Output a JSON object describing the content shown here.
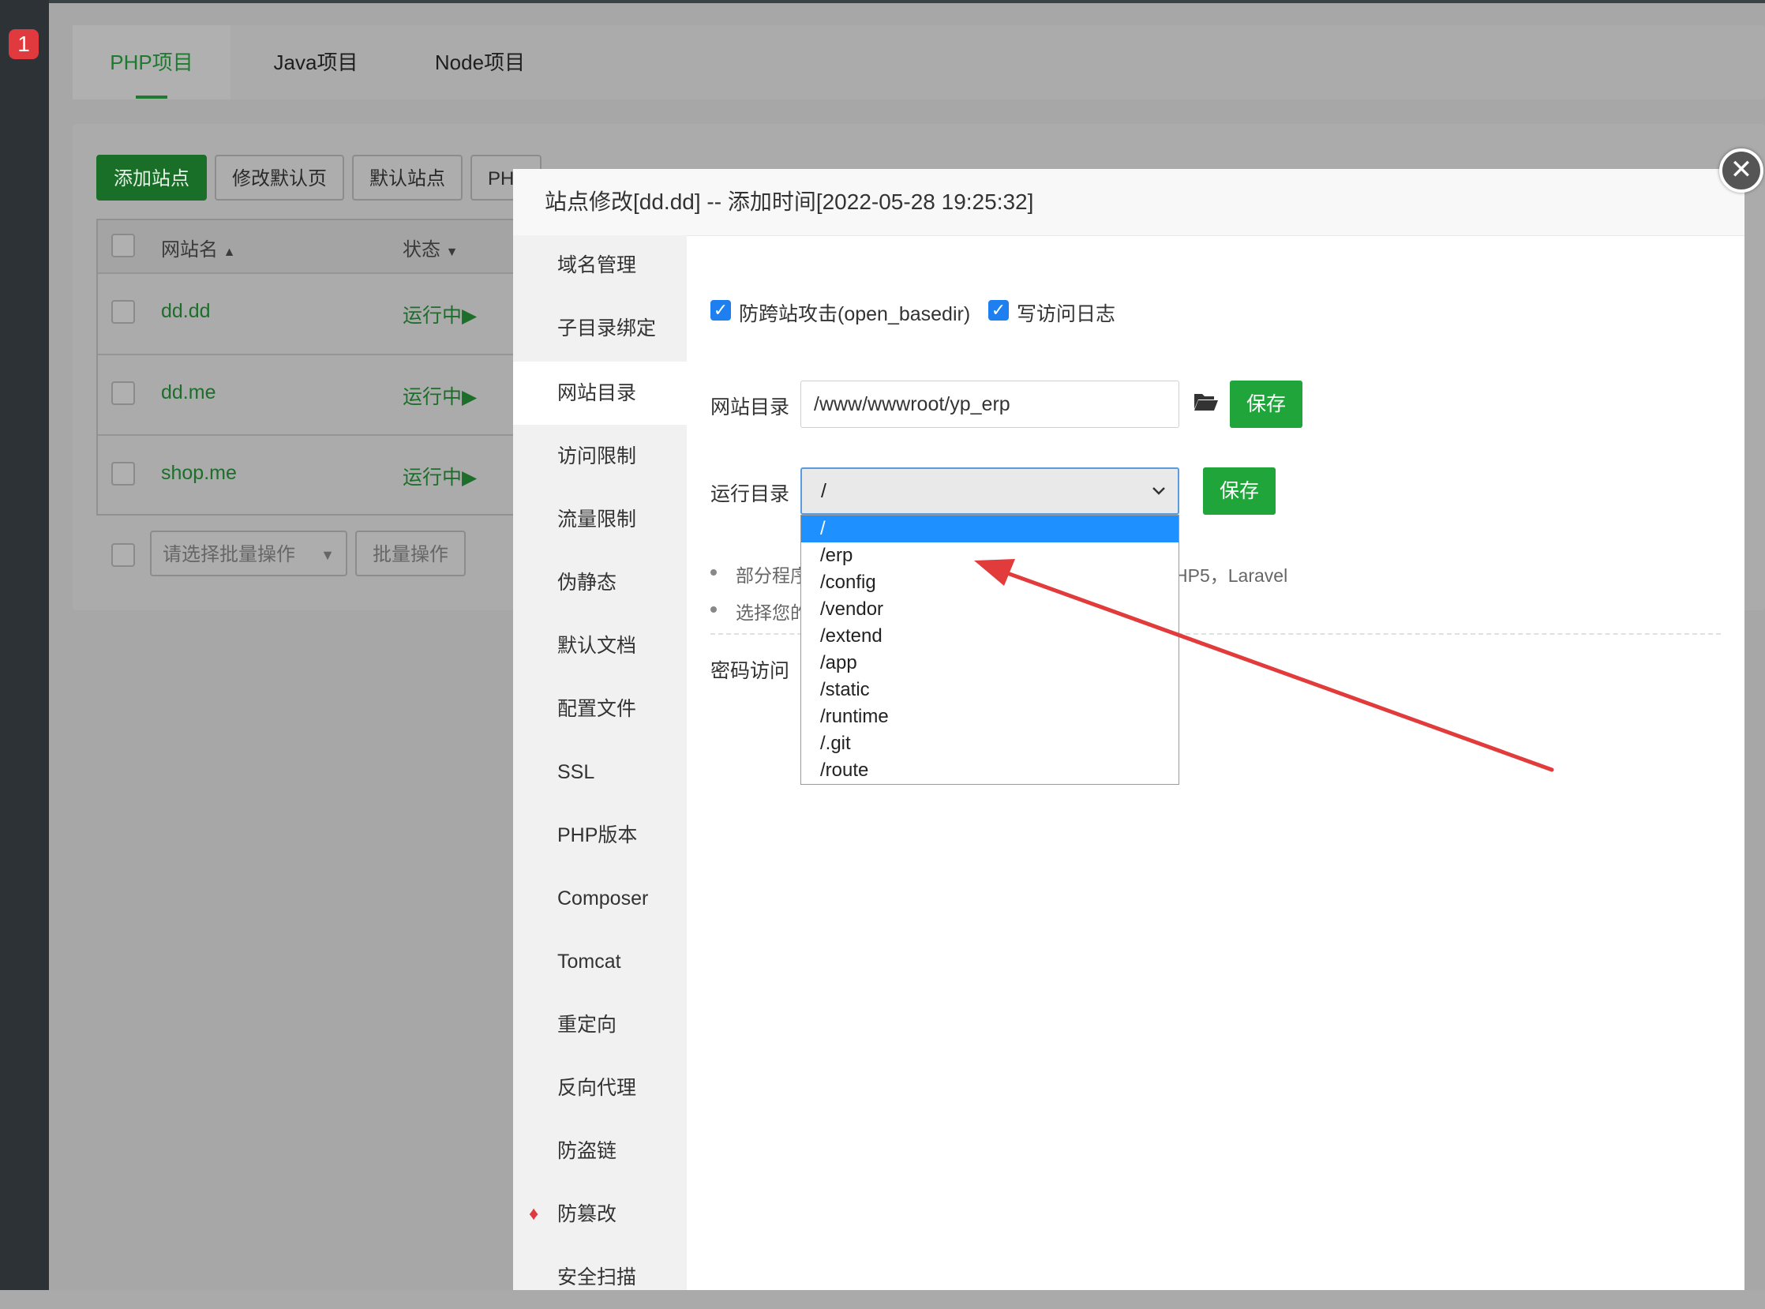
{
  "notification_badge": "1",
  "tabs": [
    {
      "label": "PHP项目"
    },
    {
      "label": "Java项目"
    },
    {
      "label": "Node项目"
    }
  ],
  "toolbar": {
    "add_site": "添加站点",
    "edit_default_page": "修改默认页",
    "default_site": "默认站点",
    "php_partial": "PH"
  },
  "table": {
    "col_name": "网站名",
    "col_status": "状态",
    "rows": [
      {
        "name": "dd.dd",
        "status": "运行中▶"
      },
      {
        "name": "dd.me",
        "status": "运行中▶"
      },
      {
        "name": "shop.me",
        "status": "运行中▶"
      }
    ],
    "batch_placeholder": "请选择批量操作",
    "batch_button": "批量操作"
  },
  "dialog": {
    "title": "站点修改[dd.dd] -- 添加时间[2022-05-28 19:25:32]",
    "menu": [
      "域名管理",
      "子目录绑定",
      "网站目录",
      "访问限制",
      "流量限制",
      "伪静态",
      "默认文档",
      "配置文件",
      "SSL",
      "PHP版本",
      "Composer",
      "Tomcat",
      "重定向",
      "反向代理",
      "防盗链",
      "防篡改",
      "安全扫描"
    ],
    "active_menu": "网站目录",
    "anti_xss_label": "防跨站攻击(open_basedir)",
    "access_log_label": "写访问日志",
    "site_dir_label": "网站目录",
    "site_dir_value": "/www/wwwroot/yp_erp",
    "save_label": "保存",
    "run_dir_label": "运行目录",
    "run_dir_value": "/",
    "run_dir_options": [
      "/",
      "/erp",
      "/config",
      "/vendor",
      "/extend",
      "/app",
      "/static",
      "/runtime",
      "/.git",
      "/route"
    ],
    "tip1_left": "部分程序",
    "tip1_right": "HP5，Laravel",
    "tip2_left": "选择您的",
    "password_access_label": "密码访问"
  },
  "colors": {
    "accent_green": "#20a53a",
    "select_blue": "#1e90ff",
    "arrow_red": "#e23b3b"
  }
}
